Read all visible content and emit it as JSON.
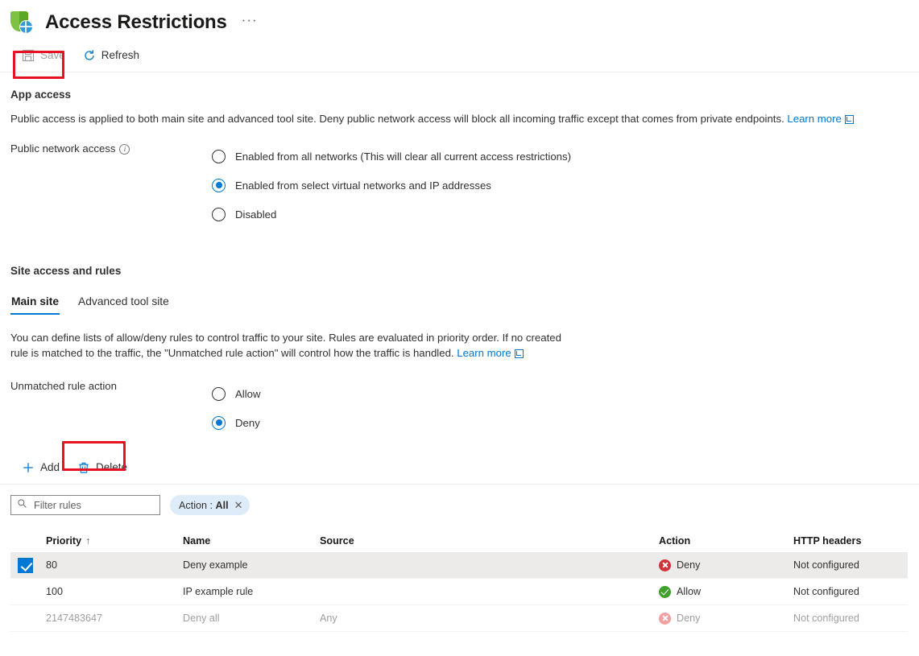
{
  "header": {
    "title": "Access Restrictions",
    "icon": "app-service-shield-icon",
    "more_label": "···"
  },
  "toolbar": {
    "save_label": "Save",
    "save_icon": "save-disk-icon",
    "save_disabled": true,
    "refresh_label": "Refresh",
    "refresh_icon": "refresh-icon"
  },
  "app_access": {
    "title": "App access",
    "description_before_link": "Public access is applied to both main site and advanced tool site. Deny public network access will block all incoming traffic except that comes from private endpoints. ",
    "learn_more": "Learn more",
    "field_label": "Public network access",
    "info_icon": "info-icon",
    "options": [
      {
        "label": "Enabled from all networks (This will clear all current access restrictions)",
        "checked": false
      },
      {
        "label": "Enabled from select virtual networks and IP addresses",
        "checked": true
      },
      {
        "label": "Disabled",
        "checked": false
      }
    ]
  },
  "site_access": {
    "title": "Site access and rules",
    "tabs": [
      {
        "label": "Main site",
        "active": true
      },
      {
        "label": "Advanced tool site",
        "active": false
      }
    ],
    "description_before_link": "You can define lists of allow/deny rules to control traffic to your site. Rules are evaluated in priority order. If no created rule is matched to the traffic, the \"Unmatched rule action\" will control how the traffic is handled. ",
    "learn_more": "Learn more",
    "unmatched_label": "Unmatched rule action",
    "unmatched_options": [
      {
        "label": "Allow",
        "checked": false
      },
      {
        "label": "Deny",
        "checked": true
      }
    ]
  },
  "rules_toolbar": {
    "add_label": "Add",
    "add_icon": "plus-icon",
    "delete_label": "Delete",
    "delete_icon": "trash-icon"
  },
  "filters": {
    "search_placeholder": "Filter rules",
    "search_value": "",
    "search_icon": "search-icon",
    "pill_label": "Action : ",
    "pill_value": "All",
    "pill_close_icon": "close-icon"
  },
  "rules_table": {
    "columns": [
      "Priority",
      "Name",
      "Source",
      "Action",
      "HTTP headers"
    ],
    "sort_column": "Priority",
    "sort_arrow": "↑",
    "rows": [
      {
        "selected": true,
        "dimmed": false,
        "priority": "80",
        "name": "Deny example",
        "source": "",
        "action": "Deny",
        "action_icon": "deny-icon",
        "http_headers": "Not configured"
      },
      {
        "selected": false,
        "dimmed": false,
        "priority": "100",
        "name": "IP example rule",
        "source": "",
        "action": "Allow",
        "action_icon": "allow-icon",
        "http_headers": "Not configured"
      },
      {
        "selected": false,
        "dimmed": true,
        "priority": "2147483647",
        "name": "Deny all",
        "source": "Any",
        "action": "Deny",
        "action_icon": "deny-icon-disabled",
        "http_headers": "Not configured"
      }
    ]
  },
  "annotations": {
    "highlight_color": "#e81123",
    "highlighted": [
      "save-button",
      "delete-button"
    ]
  },
  "colors": {
    "accent": "#0078d4",
    "deny": "#d13438",
    "allow": "#3fa02b",
    "selected_row": "#edebe9",
    "pill_bg": "#deecf9"
  }
}
